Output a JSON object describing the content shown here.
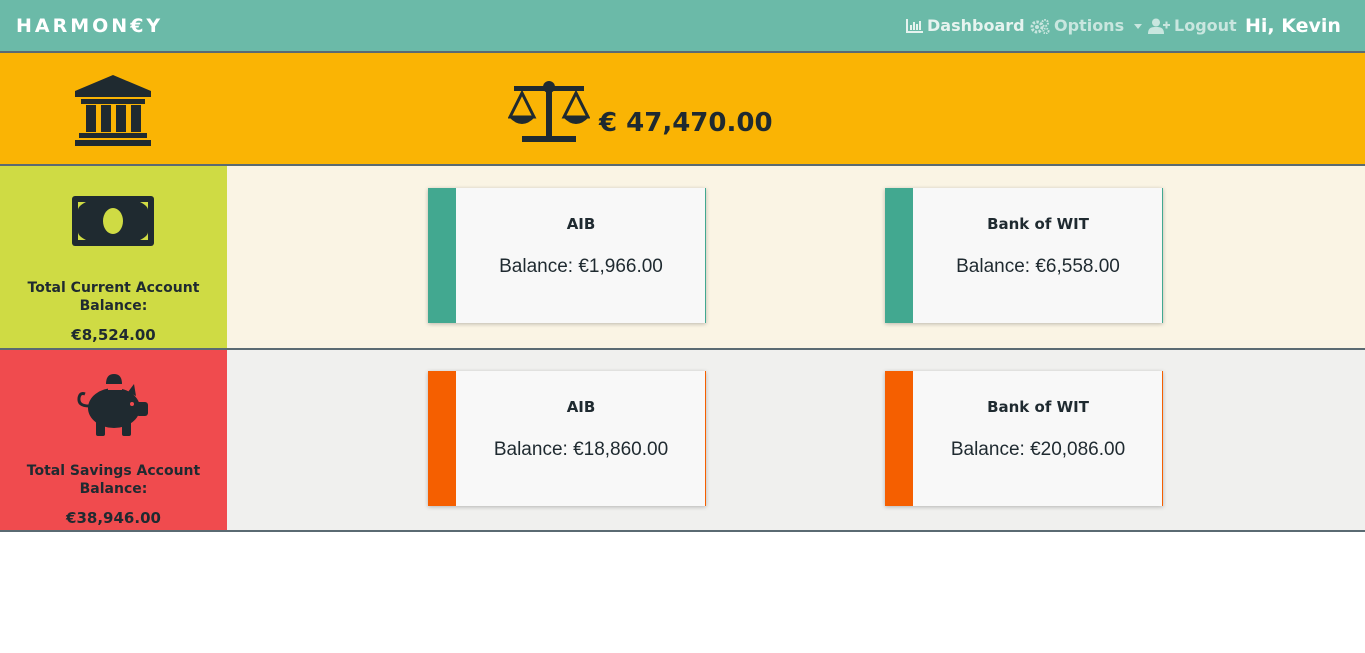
{
  "header": {
    "brand": "HARMON€Y",
    "nav": {
      "dashboard": "Dashboard",
      "options": "Options",
      "logout": "Logout"
    },
    "greeting": "Hi, Kevin"
  },
  "overview": {
    "total_amount": "€ 47,470.00"
  },
  "current": {
    "title": "Total Current Account Balance:",
    "total": "€8,524.00",
    "accounts": [
      {
        "name": "AIB",
        "balance": "Balance: €1,966.00"
      },
      {
        "name": "Bank of WIT",
        "balance": "Balance: €6,558.00"
      }
    ]
  },
  "savings": {
    "title": "Total Savings Account Balance:",
    "total": "€38,946.00",
    "accounts": [
      {
        "name": "AIB",
        "balance": "Balance: €18,860.00"
      },
      {
        "name": "Bank of WIT",
        "balance": "Balance: €20,086.00"
      }
    ]
  },
  "colors": {
    "navbar": "#6bbaa8",
    "total_band": "#fab404",
    "current_side": "#cfdb44",
    "savings_side": "#f04b4e",
    "current_accent": "#42a890",
    "savings_accent": "#f55f00"
  },
  "icons": {
    "brand": "none",
    "dashboard": "bar-chart-icon",
    "options": "gears-icon",
    "logout": "user-plus-icon",
    "overview_left": "bank-icon",
    "overview_total": "balance-scale-icon",
    "current": "banknote-icon",
    "savings": "piggy-bank-icon"
  }
}
